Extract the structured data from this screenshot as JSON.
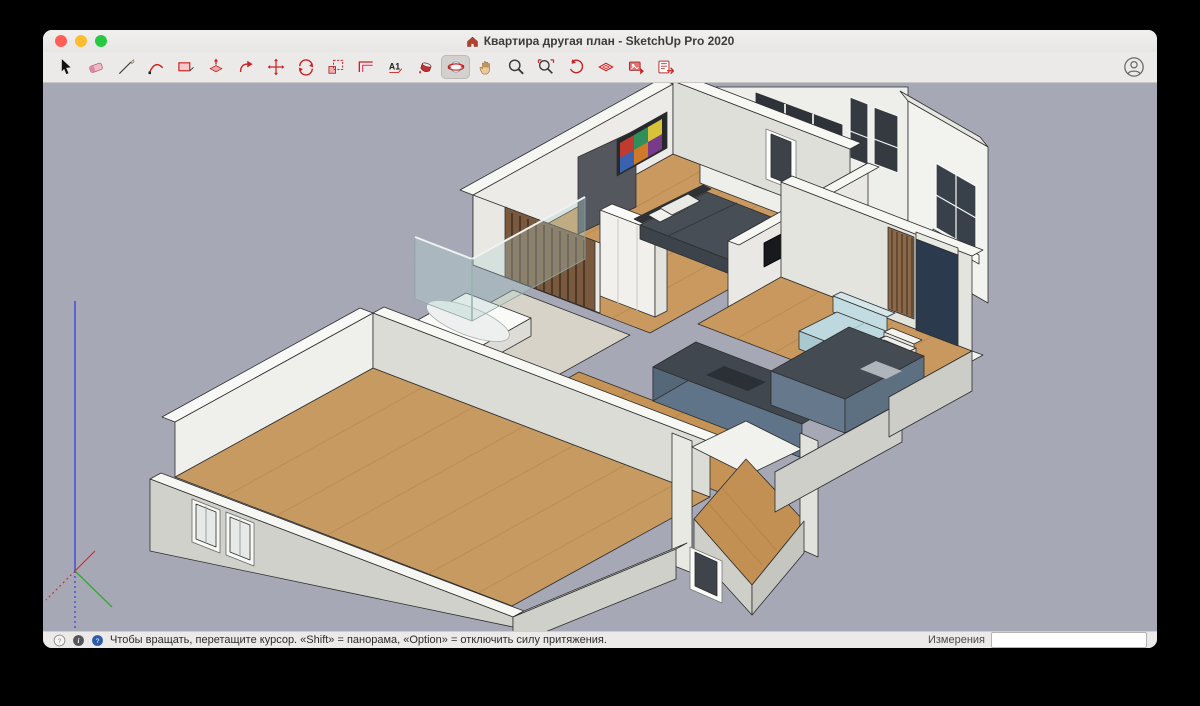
{
  "window": {
    "title": "Квартира другая план - SketchUp Pro 2020"
  },
  "titlebar": {
    "traffic_lights": [
      "close",
      "minimize",
      "zoom"
    ]
  },
  "toolbar": {
    "active_tool": "orbit",
    "tools": [
      {
        "name": "select"
      },
      {
        "name": "eraser"
      },
      {
        "name": "line"
      },
      {
        "name": "arc"
      },
      {
        "name": "rectangle"
      },
      {
        "name": "push-pull"
      },
      {
        "name": "follow-me"
      },
      {
        "name": "move"
      },
      {
        "name": "rotate"
      },
      {
        "name": "scale"
      },
      {
        "name": "offset"
      },
      {
        "name": "text"
      },
      {
        "name": "paint-bucket"
      },
      {
        "name": "orbit"
      },
      {
        "name": "pan"
      },
      {
        "name": "zoom"
      },
      {
        "name": "zoom-extents"
      },
      {
        "name": "previous-view"
      },
      {
        "name": "section-plane"
      },
      {
        "name": "export-image"
      },
      {
        "name": "send-to-layout"
      }
    ]
  },
  "account": {
    "icon": "user-circle-icon"
  },
  "viewport": {
    "background": "#a6a8b5",
    "colors": {
      "wall_white": "#efefeb",
      "wall_gray": "#d1d1cb",
      "floor_wood": "#c79a62",
      "sofa_blue": "#bdd9df",
      "bed_dark": "#474e56",
      "kitchen_counter": "#41474f",
      "cabinet_blue": "#66798c",
      "accent_navy": "#2c3a4d",
      "axis_red": "#d03030",
      "axis_green": "#2faa2f",
      "axis_blue": "#3a3ae0"
    }
  },
  "status_bar": {
    "hint": "Чтобы вращать, перетащите курсор. «Shift» = панорама, «Option» = отключить силу притяжения.",
    "measurements_label": "Измерения",
    "measurements_value": ""
  }
}
